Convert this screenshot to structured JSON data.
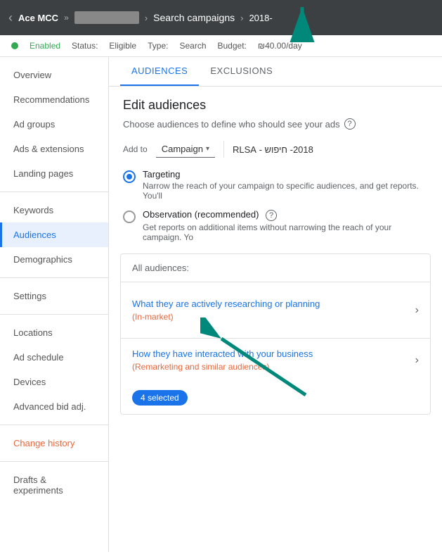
{
  "topbar": {
    "back_arrow": "‹",
    "ace": "Ace MCC",
    "double_arrow": "»",
    "separator": ">",
    "campaign_label": "Search campaigns",
    "year_label": "2018-"
  },
  "status": {
    "enabled": "Enabled",
    "status_label": "Status:",
    "status_value": "Eligible",
    "type_label": "Type:",
    "type_value": "Search",
    "budget_label": "Budget:",
    "budget_value": "₪40.00/day"
  },
  "tabs": {
    "audiences": "AUDIENCES",
    "exclusions": "EXCLUSIONS"
  },
  "content": {
    "title": "Edit audiences",
    "subtitle": "Choose audiences to define who should see your ads",
    "add_to_label": "Add to",
    "campaign_dropdown": "Campaign",
    "campaign_name": "2018- חיפוש - RLSA",
    "targeting_label": "Targeting",
    "targeting_desc": "Narrow the reach of your campaign to specific audiences, and get reports. You'll",
    "observation_label": "Observation (recommended)",
    "observation_desc": "Get reports on additional items without narrowing the reach of your campaign. Yo",
    "audiences_section_header": "All audiences:",
    "audience1_title": "What they are actively researching or planning",
    "audience1_subtitle": "(In-market)",
    "audience2_title": "How they have interacted with your business",
    "audience2_subtitle": "(Remarketing and similar audiences)",
    "selected_badge": "4 selected"
  },
  "sidebar": {
    "items": [
      {
        "label": "Overview",
        "active": false
      },
      {
        "label": "Recommendations",
        "active": false
      },
      {
        "label": "Ad groups",
        "active": false
      },
      {
        "label": "Ads & extensions",
        "active": false
      },
      {
        "label": "Landing pages",
        "active": false
      },
      {
        "label": "Keywords",
        "active": false
      },
      {
        "label": "Audiences",
        "active": true
      },
      {
        "label": "Demographics",
        "active": false
      },
      {
        "label": "Settings",
        "active": false
      },
      {
        "label": "Locations",
        "active": false
      },
      {
        "label": "Ad schedule",
        "active": false
      },
      {
        "label": "Devices",
        "active": false
      },
      {
        "label": "Advanced bid adj.",
        "active": false
      },
      {
        "label": "Change history",
        "active": false
      },
      {
        "label": "Drafts & experiments",
        "active": false
      }
    ]
  }
}
